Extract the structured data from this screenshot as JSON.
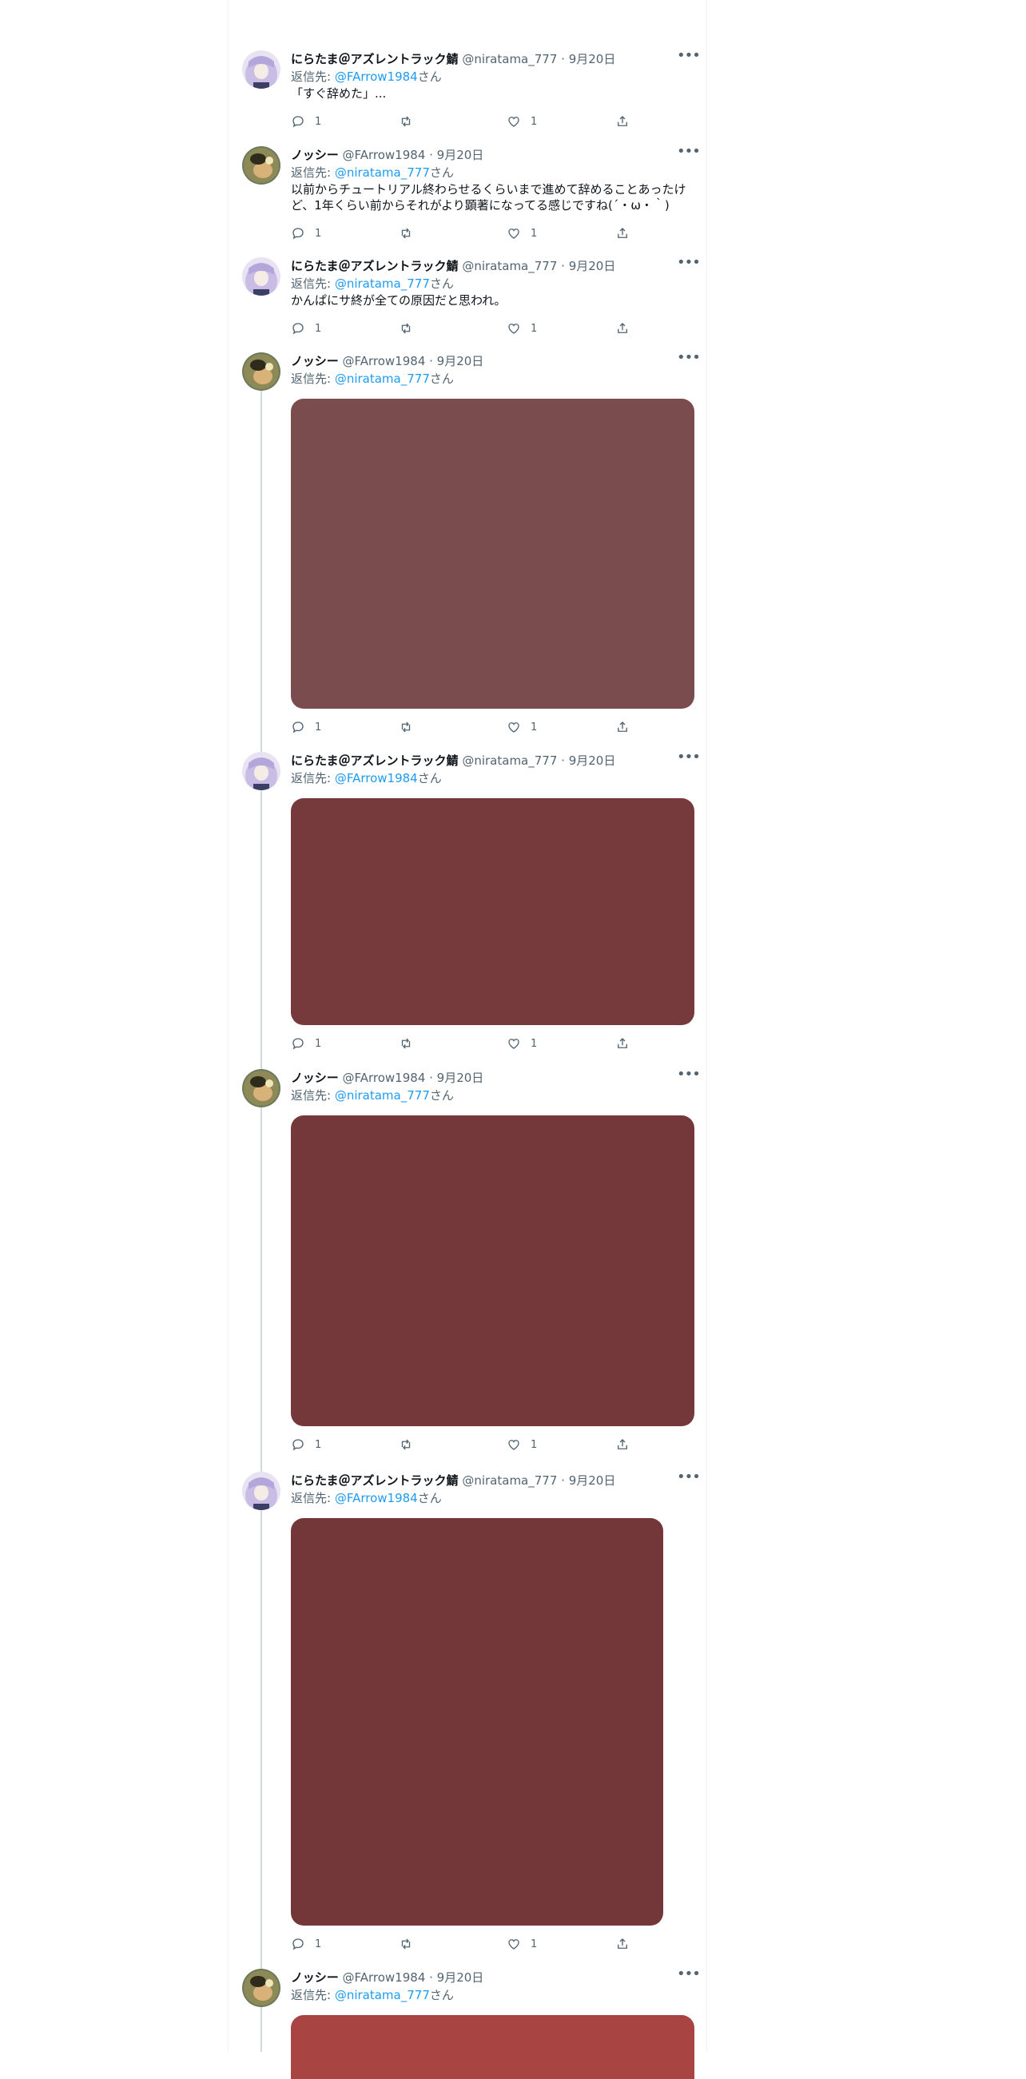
{
  "users": {
    "niratama": {
      "name": "にらたま＠アズレントラック鯖",
      "handle": "@niratama_777"
    },
    "fa": {
      "name": "ノッシー",
      "handle": "@FArrow1984"
    }
  },
  "meta_sep": " · ",
  "reply_prefix": "返信先: ",
  "reply_suffix": "さん",
  "tweets": [
    {
      "name": "にらたま＠アズレントラック鯖",
      "handle": "@niratama_777",
      "date": "9月20日",
      "reply_to": "@FArrow1984",
      "text": "「すぐ辞めた」...",
      "reply_count": "1",
      "like_count": "1"
    },
    {
      "name": "ノッシー",
      "handle": "@FArrow1984",
      "date": "9月20日",
      "reply_to": "@niratama_777",
      "text": "以前からチュートリアル終わらせるくらいまで進めて辞めることあったけど、1年くらい前からそれがより顕著になってる感じですね(´・ω・｀)",
      "reply_count": "1",
      "like_count": "1"
    },
    {
      "name": "にらたま＠アズレントラック鯖",
      "handle": "@niratama_777",
      "date": "9月20日",
      "reply_to": "@niratama_777",
      "text": "かんぱにサ終が全ての原因だと思われ。",
      "reply_count": "1",
      "like_count": "1"
    },
    {
      "name": "ノッシー",
      "handle": "@FArrow1984",
      "date": "9月20日",
      "reply_to": "@niratama_777",
      "media_color": "#7a4c4e",
      "reply_count": "1",
      "like_count": "1"
    },
    {
      "name": "にらたま＠アズレントラック鯖",
      "handle": "@niratama_777",
      "date": "9月20日",
      "reply_to": "@FArrow1984",
      "media_color": "#763a3c",
      "reply_count": "1",
      "like_count": "1"
    },
    {
      "name": "ノッシー",
      "handle": "@FArrow1984",
      "date": "9月20日",
      "reply_to": "@niratama_777",
      "media_color": "#75383a",
      "reply_count": "1",
      "like_count": "1"
    },
    {
      "name": "にらたま＠アズレントラック鯖",
      "handle": "@niratama_777",
      "date": "9月20日",
      "reply_to": "@FArrow1984",
      "media_color": "#743739",
      "reply_count": "1",
      "like_count": "1"
    },
    {
      "name": "ノッシー",
      "handle": "@FArrow1984",
      "date": "9月20日",
      "reply_to": "@niratama_777",
      "media_color": "#a84442"
    }
  ],
  "icons": [
    "more-icon",
    "reply-icon",
    "retweet-icon",
    "like-icon",
    "share-icon"
  ],
  "colors": {
    "link": "#1d9bf0",
    "muted": "#536471",
    "border": "#eff3f4"
  }
}
